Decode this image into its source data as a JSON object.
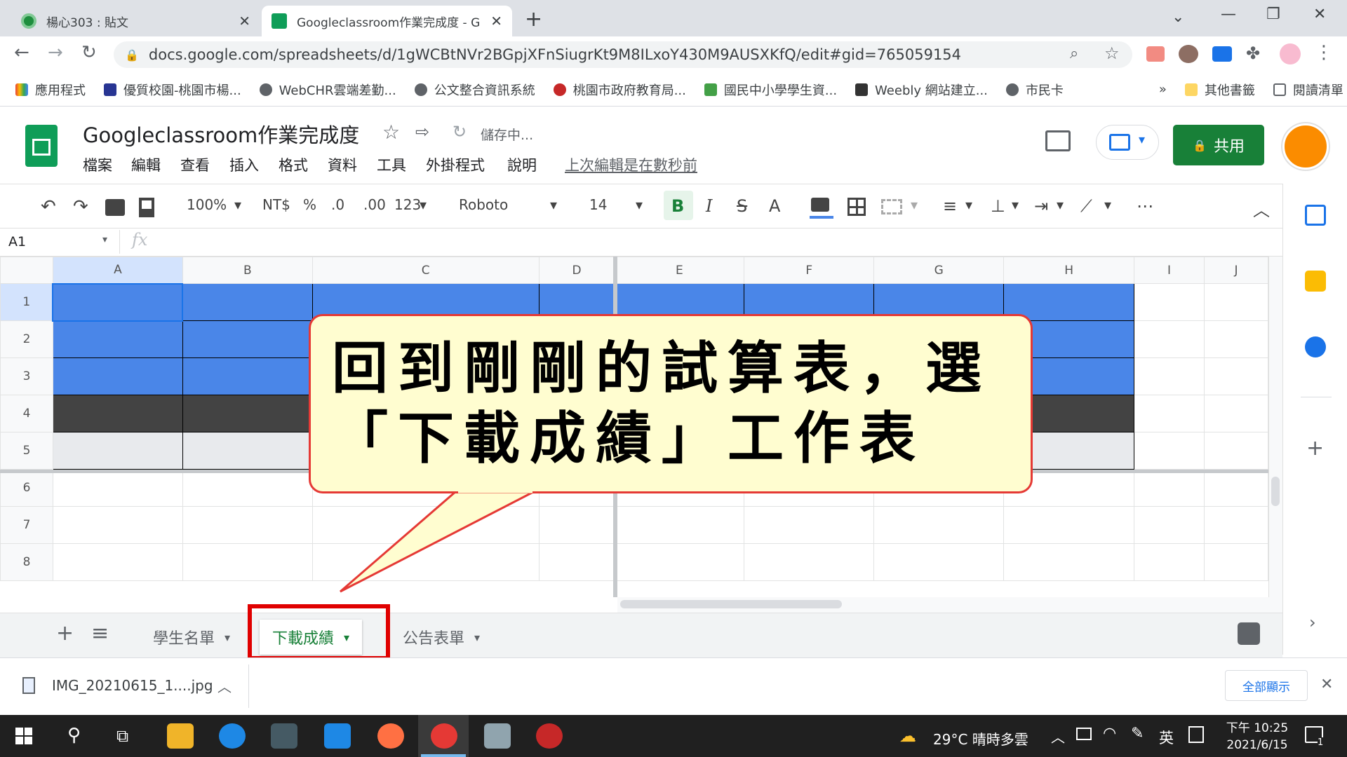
{
  "browser": {
    "tabs": [
      {
        "label": "楊心303 : 貼文",
        "icon": "classroom-icon"
      },
      {
        "label": "Googleclassroom作業完成度 - G",
        "icon": "sheets-icon"
      }
    ],
    "url": "docs.google.com/spreadsheets/d/1gWCBtNVr2BGpjXFnSiugrKt9M8ILxoY430M9AUSXKfQ/edit#gid=765059154",
    "bookmarks": [
      "應用程式",
      "優質校園-桃園市楊...",
      "WebCHR雲端差勤...",
      "公文整合資訊系統",
      "桃園市政府教育局...",
      "國民中小學學生資...",
      "Weebly 網站建立...",
      "市民卡"
    ],
    "bookmarks_more": "»",
    "other_bookmarks": "其他書籤",
    "reading_list": "閱讀清單"
  },
  "sheet": {
    "title": "Googleclassroom作業完成度",
    "saving": "儲存中...",
    "menus": [
      "檔案",
      "編輯",
      "查看",
      "插入",
      "格式",
      "資料",
      "工具",
      "外掛程式",
      "說明"
    ],
    "last_edit": "上次編輯是在數秒前",
    "share": "共用",
    "toolbar": {
      "zoom": "100%",
      "currency": "NT$",
      "percent": "%",
      "dec_less": ".0",
      "dec_more": ".00",
      "format": "123",
      "font": "Roboto",
      "font_size": "14",
      "bold": "B",
      "italic": "I",
      "strike": "S",
      "textcolor": "A"
    },
    "namebox": "A1",
    "fx": "fx",
    "columns": [
      "A",
      "B",
      "C",
      "D",
      "E",
      "F",
      "G",
      "H",
      "I",
      "J"
    ],
    "rows": [
      "1",
      "2",
      "3",
      "4",
      "5",
      "6",
      "7",
      "8"
    ],
    "sheet_tabs": [
      "學生名單",
      "下載成績",
      "公告表單"
    ],
    "active_sheet": "下載成績"
  },
  "callout": {
    "line1": "回到剛剛的試算表，選",
    "line2": "「下載成績」工作表"
  },
  "download": {
    "file": "IMG_20210615_1....jpg",
    "show_all": "全部顯示"
  },
  "taskbar": {
    "weather": "29°C  晴時多雲",
    "ime": "英",
    "time": "下午 10:25",
    "date": "2021/6/15",
    "notify_count": "1"
  },
  "colors": {
    "header_blue": "#4a86e8",
    "dark_row": "#434343",
    "light_row": "#e8eaed",
    "share_green": "#188038",
    "highlight_red": "#e00000",
    "callout_bg": "#fffdd0"
  }
}
